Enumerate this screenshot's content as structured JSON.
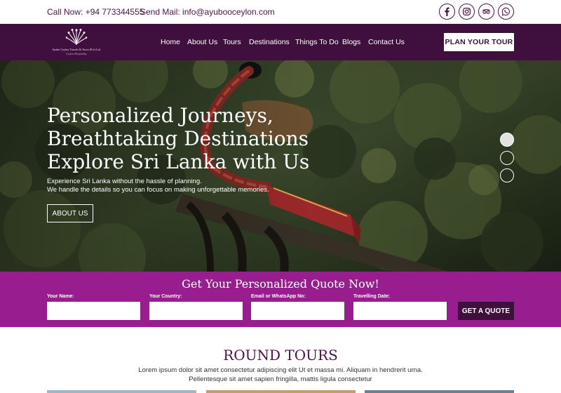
{
  "topbar": {
    "call": "Call Now: +94 773344555",
    "mail": "Send Mail: info@ayubooceylon.com",
    "social": [
      {
        "icon": "facebook-icon"
      },
      {
        "icon": "instagram-icon"
      },
      {
        "icon": "tripadvisor-icon"
      },
      {
        "icon": "whatsapp-icon"
      }
    ]
  },
  "brand": {
    "name": "Ayubo Ceylon Travels & Tours (Pvt) Ltd.",
    "tagline": "Ceylon Hospitality"
  },
  "nav": {
    "items": [
      "Home",
      "About Us",
      "Tours",
      "Destinations",
      "Things To Do",
      "Blogs",
      "Contact Us"
    ],
    "cta": "PLAN YOUR TOUR"
  },
  "hero": {
    "title_lines": [
      "Personalized Journeys,",
      "Breathtaking Destinations",
      "Explore Sri Lanka with Us"
    ],
    "sub_lines": [
      "Experience Sri Lanka without the hassle of planning.",
      "We handle the details so you can focus on making unforgettable memories."
    ],
    "button": "ABOUT US",
    "slides": {
      "count": 3,
      "active": 1
    }
  },
  "quote": {
    "title": "Get Your Personalized Quote Now!",
    "fields": [
      {
        "label": "Your Name:",
        "value": ""
      },
      {
        "label": "Your Country:",
        "value": ""
      },
      {
        "label": "Email or WhatsApp No:",
        "value": ""
      },
      {
        "label": "Travelling Date:",
        "value": ""
      }
    ],
    "button": "GET A QUOTE"
  },
  "round_tours": {
    "title": "ROUND TOURS",
    "desc_lines": [
      "Lorem ipsum dolor sit amet consectetur adipiscing elit Ut et massa mi. Aliquam in hendrerit urna.",
      "Pellentesque sit amet sapien fringilla, mattis ligula consectetur"
    ]
  },
  "colors": {
    "brand_dark": "#3f0f3d",
    "brand_magenta": "#981e8f",
    "text_purple": "#4a1546"
  }
}
